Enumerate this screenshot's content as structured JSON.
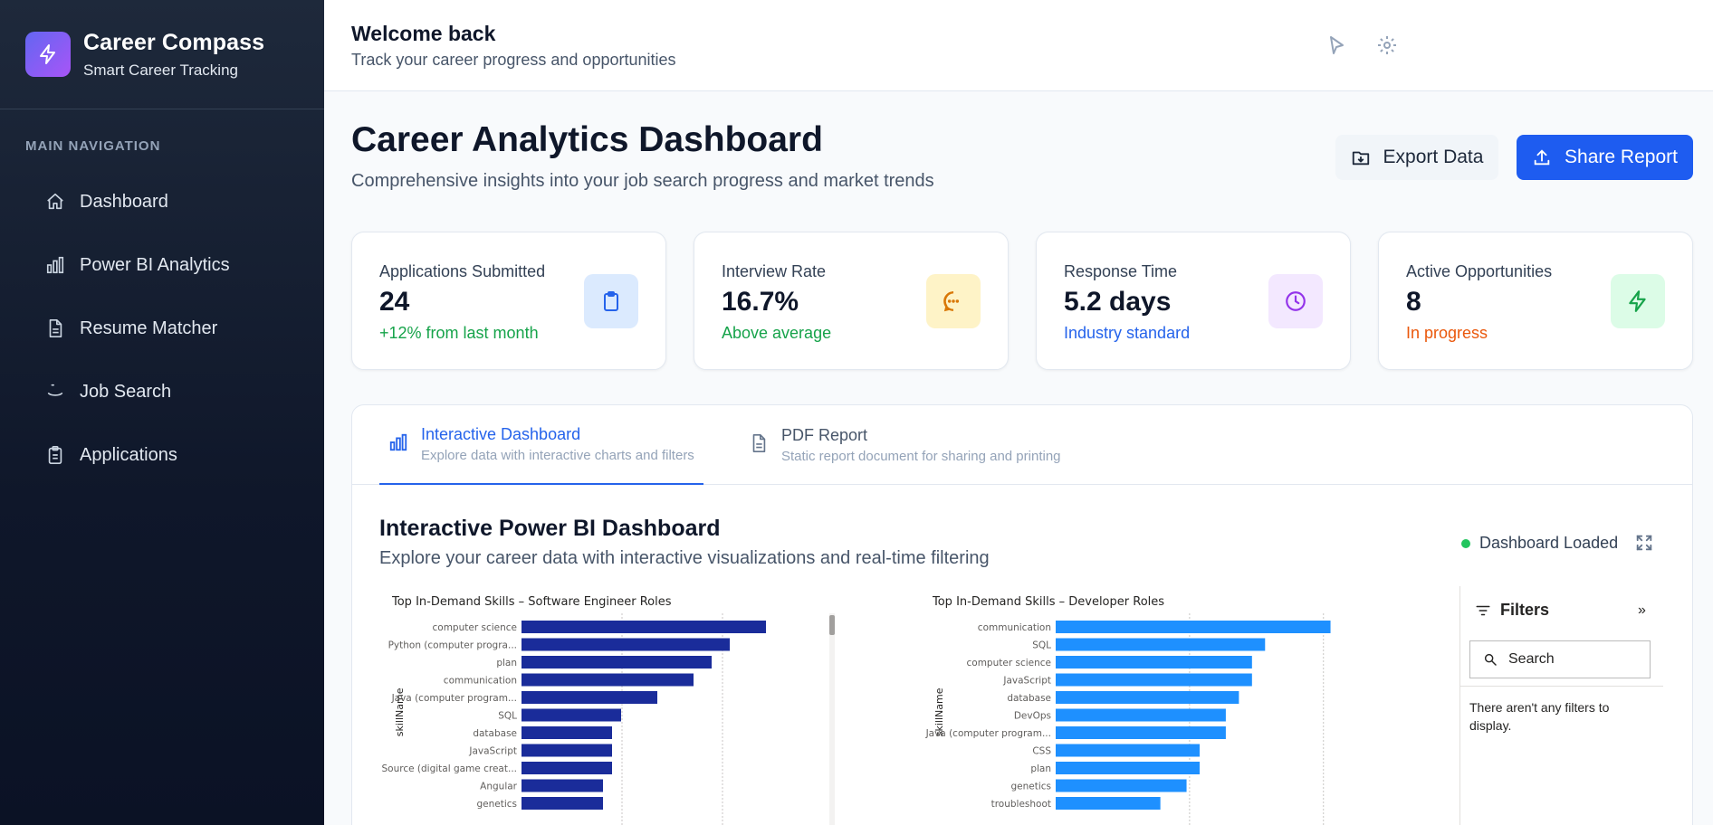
{
  "brand": {
    "title": "Career Compass",
    "subtitle": "Smart Career Tracking"
  },
  "nav": {
    "heading": "MAIN NAVIGATION",
    "items": [
      {
        "label": "Dashboard",
        "icon": "home-icon"
      },
      {
        "label": "Power BI Analytics",
        "icon": "bar-chart-icon"
      },
      {
        "label": "Resume Matcher",
        "icon": "document-icon"
      },
      {
        "label": "Job Search",
        "icon": "search-icon"
      },
      {
        "label": "Applications",
        "icon": "clipboard-icon"
      }
    ]
  },
  "topbar": {
    "title": "Welcome back",
    "subtitle": "Track your career progress and opportunities"
  },
  "page": {
    "title": "Career Analytics Dashboard",
    "subtitle": "Comprehensive insights into your job search progress and market trends",
    "export_label": "Export Data",
    "share_label": "Share Report"
  },
  "cards": [
    {
      "label": "Applications Submitted",
      "value": "24",
      "note": "+12% from last month",
      "note_color": "#16a34a",
      "icon": "clipboard-icon",
      "icon_bg": "#dbeafe",
      "icon_color": "#2563eb"
    },
    {
      "label": "Interview Rate",
      "value": "16.7%",
      "note": "Above average",
      "note_color": "#16a34a",
      "icon": "chat-icon",
      "icon_bg": "#fef3c7",
      "icon_color": "#d97706"
    },
    {
      "label": "Response Time",
      "value": "5.2 days",
      "note": "Industry standard",
      "note_color": "#2563eb",
      "icon": "clock-icon",
      "icon_bg": "#f3e8ff",
      "icon_color": "#9333ea"
    },
    {
      "label": "Active Opportunities",
      "value": "8",
      "note": "In progress",
      "note_color": "#ea580c",
      "icon": "bolt-icon",
      "icon_bg": "#dcfce7",
      "icon_color": "#16a34a"
    }
  ],
  "tabs": [
    {
      "label": "Interactive Dashboard",
      "desc": "Explore data with interactive charts and filters"
    },
    {
      "label": "PDF Report",
      "desc": "Static report document for sharing and printing"
    }
  ],
  "powerbi": {
    "title": "Interactive Power BI Dashboard",
    "subtitle": "Explore your career data with interactive visualizations and real-time filtering",
    "status": "Dashboard Loaded"
  },
  "filters": {
    "title": "Filters",
    "search_placeholder": "Search",
    "empty": "There aren't any filters to display."
  },
  "colors": {
    "chart1": "#1a2c9a",
    "chart2": "#1e90ff",
    "accent": "#2563eb"
  },
  "chart_data": [
    {
      "type": "bar",
      "orientation": "horizontal",
      "title": "Top In-Demand Skills – Software Engineer Roles",
      "ylabel": "skillName",
      "categories": [
        "computer science",
        "Python (computer progra...",
        "plan",
        "communication",
        "Java (computer program...",
        "SQL",
        "database",
        "JavaScript",
        "Source (digital game creat...",
        "Angular",
        "genetics"
      ],
      "values": [
        27,
        23,
        21,
        19,
        15,
        11,
        10,
        10,
        10,
        9,
        9
      ],
      "xlim": [
        0,
        30
      ]
    },
    {
      "type": "bar",
      "orientation": "horizontal",
      "title": "Top In-Demand Skills – Developer Roles",
      "ylabel": "skillName",
      "categories": [
        "communication",
        "SQL",
        "computer science",
        "JavaScript",
        "database",
        "DevOps",
        "Java (computer program...",
        "CSS",
        "plan",
        "genetics",
        "troubleshoot"
      ],
      "values": [
        21,
        16,
        15,
        15,
        14,
        13,
        13,
        11,
        11,
        10,
        8
      ],
      "xlim": [
        0,
        22
      ]
    }
  ]
}
